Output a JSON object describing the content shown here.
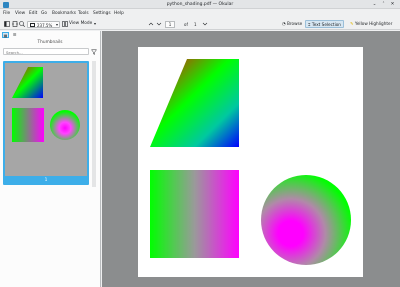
{
  "window": {
    "title": "python_shading.pdf — Okular",
    "controls": [
      "⌄",
      "˄",
      "✕"
    ]
  },
  "menu": [
    "File",
    "View",
    "Edit",
    "Go",
    "Bookmarks",
    "Tools",
    "Settings",
    "Help"
  ],
  "toolbar": {
    "zoom": "237.5%",
    "view_mode": "View Mode",
    "current_page": "1",
    "of_label": "of",
    "total_pages": "1",
    "browse": "Browse",
    "text_selection": "Text Selection",
    "yellow_highlighter": "Yellow Highlighter"
  },
  "sidebar": {
    "title": "Thumbnails",
    "search_placeholder": "Search...",
    "thumbnail_label": "1"
  },
  "colors": {
    "accent": "#3daee9",
    "viewer_bg": "#8b8d8e",
    "thumb_bg": "#a6a6a6"
  }
}
